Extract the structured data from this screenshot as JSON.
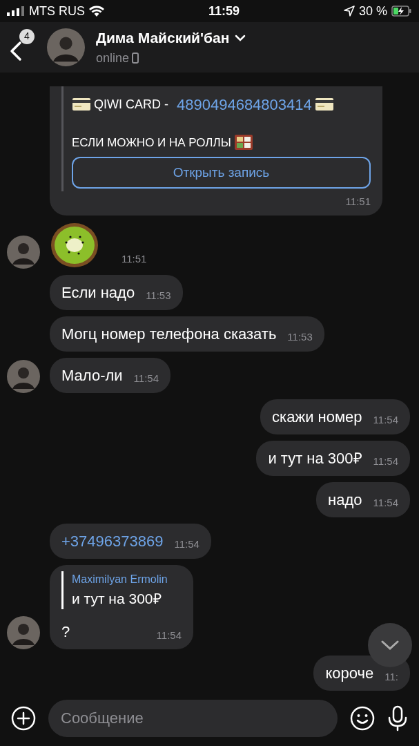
{
  "status_bar": {
    "carrier": "MTS RUS",
    "time": "11:59",
    "battery": "30 %"
  },
  "header": {
    "unread_count": "4",
    "name": "Дима Майский'бан",
    "status": "online"
  },
  "messages": [
    {
      "kind": "post",
      "outgoing": false,
      "avatar": false,
      "card_label": "QIWI CARD -",
      "card_number": "4890494684803414",
      "text": "ЕСЛИ МОЖНО И НА РОЛЛЫ",
      "button": "Открыть запись",
      "time": "11:51"
    },
    {
      "kind": "sticker",
      "outgoing": false,
      "avatar": true,
      "time": "11:51"
    },
    {
      "kind": "text",
      "outgoing": false,
      "avatar": false,
      "text": "Если надо",
      "time": "11:53"
    },
    {
      "kind": "text",
      "outgoing": false,
      "avatar": false,
      "text": "Могц номер телефона сказать",
      "time": "11:53"
    },
    {
      "kind": "text",
      "outgoing": false,
      "avatar": true,
      "text": "Мало-ли",
      "time": "11:54"
    },
    {
      "kind": "text",
      "outgoing": true,
      "text": "скажи номер",
      "time": "11:54"
    },
    {
      "kind": "text",
      "outgoing": true,
      "text": "и тут на 300₽",
      "time": "11:54"
    },
    {
      "kind": "text",
      "outgoing": true,
      "text": "надо",
      "time": "11:54"
    },
    {
      "kind": "link",
      "outgoing": false,
      "avatar": false,
      "text": "+37496373869",
      "time": "11:54"
    },
    {
      "kind": "reply",
      "outgoing": false,
      "avatar": true,
      "quote_author": "Maximilyan Ermolin",
      "quote_text": "и тут на 300₽",
      "text": "?",
      "time": "11:54"
    },
    {
      "kind": "text",
      "outgoing": true,
      "text": "короче",
      "time": "11:"
    }
  ],
  "composer": {
    "placeholder": "Сообщение"
  }
}
